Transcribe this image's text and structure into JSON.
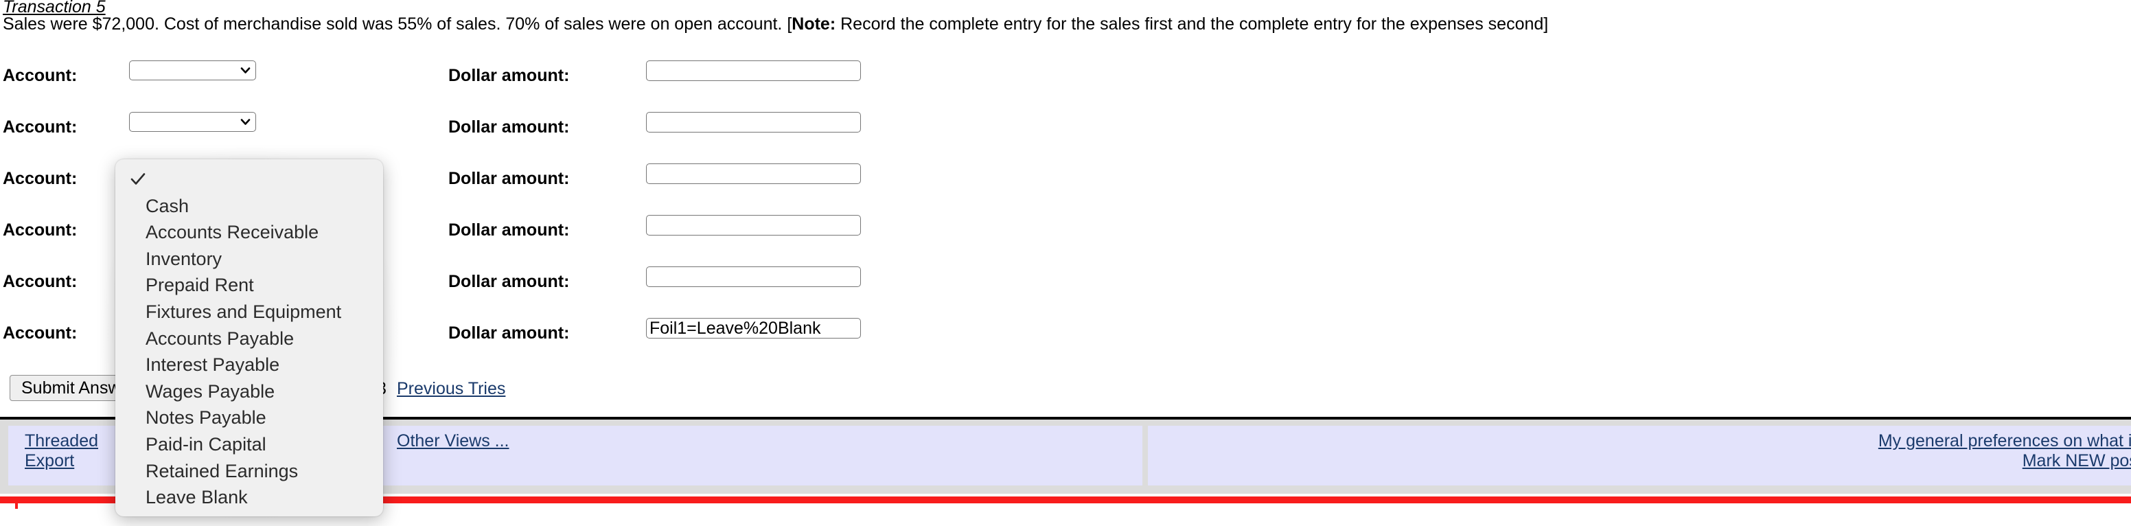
{
  "question": {
    "title": "Transaction 5",
    "body": "Sales were $72,000. Cost of merchandise sold was 55% of sales. 70% of sales were on open account. [",
    "note_label": "Note:",
    "body_after_note": " Record the complete entry for the sales first and the complete entry for the expenses second]"
  },
  "form": {
    "account_label": "Account:",
    "dollar_label": "Dollar amount:",
    "rows": [
      {
        "account_value": "",
        "dollar_value": ""
      },
      {
        "account_value": "",
        "dollar_value": ""
      },
      {
        "account_value": "",
        "dollar_value": ""
      },
      {
        "account_value": "",
        "dollar_value": ""
      },
      {
        "account_value": "",
        "dollar_value": ""
      },
      {
        "account_value": "",
        "dollar_value": "Foil1=Leave%20Blank"
      }
    ],
    "account_options": [
      "",
      "Cash",
      "Accounts Receivable",
      "Inventory",
      "Prepaid Rent",
      "Fixtures and Equipment",
      "Accounts Payable",
      "Interest Payable",
      "Wages Payable",
      "Notes Payable",
      "Paid-in Capital",
      "Retained Earnings",
      "Leave Blank"
    ]
  },
  "submit": {
    "button_label": "Submit Answer",
    "tries_count": "3",
    "previous_tries_label": "Previous Tries"
  },
  "dropdown": {
    "selected_index": 0,
    "items": [
      "",
      "Cash",
      "Accounts Receivable",
      "Inventory",
      "Prepaid Rent",
      "Fixtures and Equipment",
      "Accounts Payable",
      "Interest Payable",
      "Wages Payable",
      "Notes Payable",
      "Paid-in Capital",
      "Retained Earnings",
      "Leave Blank"
    ]
  },
  "footer": {
    "threaded": "Threaded",
    "export": "Export",
    "other_views": "Other Views ...",
    "preferences": "My general preferences on what is mar",
    "mark_new": "Mark NEW posts no"
  },
  "colors": {
    "link": "#1a3a6b",
    "footer_cell": "#e3e3fb",
    "footer_band": "#dcdcdc",
    "red_bar": "#f81c1c",
    "popup_bg": "#f0f0f0"
  }
}
